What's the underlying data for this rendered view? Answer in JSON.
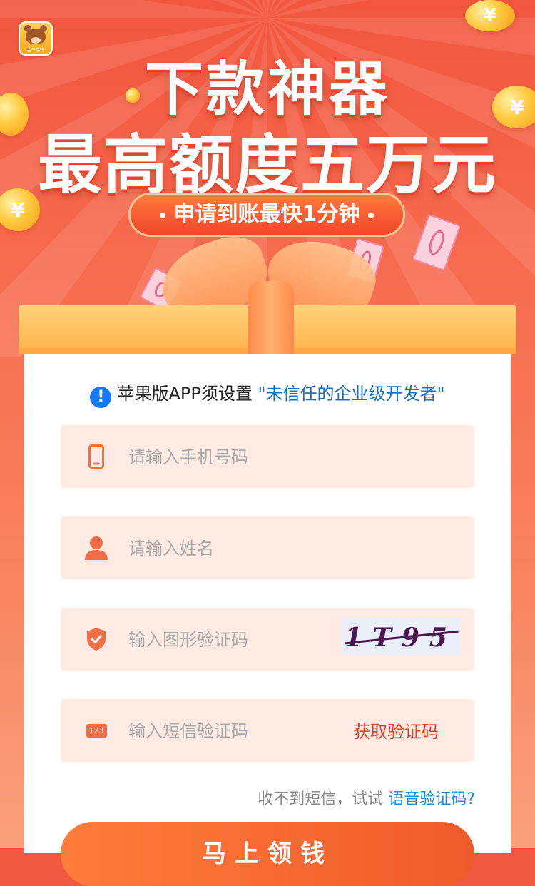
{
  "banner": {
    "logo_text": "金牛借钱",
    "title_line1": "下款神器",
    "title_line2": "最高额度五万元",
    "pill_text": "申请到账最快1分钟",
    "coin_symbol": "¥"
  },
  "notice": {
    "info_icon": "!",
    "text": "苹果版APP须设置",
    "link": "\"未信任的企业级开发者\""
  },
  "form": {
    "phone_placeholder": "请输入手机号码",
    "name_placeholder": "请输入姓名",
    "captcha_placeholder": "输入图形验证码",
    "captcha_text": "1T95",
    "sms_placeholder": "输入短信验证码",
    "sms_icon_text": "123",
    "sms_button": "获取验证码",
    "voice_prefix": "收不到短信，试试",
    "voice_link": "语音验证码?",
    "submit": "马上领钱"
  },
  "colors": {
    "accent": "#f05a2a",
    "field_bg": "#ffebe3",
    "link_blue": "#1a6fc4",
    "sms_red": "#e23b2a"
  }
}
